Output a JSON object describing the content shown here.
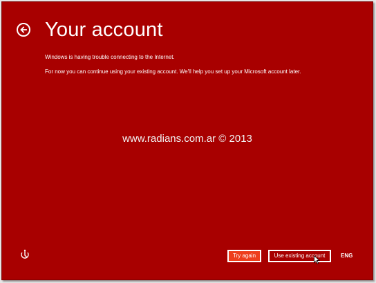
{
  "page": {
    "title": "Your account",
    "message_line1": "Windows is having trouble connecting to the Internet.",
    "message_line2": "For now you can continue using your existing account. We'll help you set up your Microsoft account later.",
    "watermark": "www.radians.com.ar © 2013"
  },
  "footer": {
    "try_again_label": "Try again",
    "use_existing_label": "Use existing account",
    "language": "ENG"
  },
  "icons": {
    "back": "back-arrow-icon",
    "ease_of_access": "ease-of-access-icon",
    "cursor": "mouse-pointer-icon"
  },
  "colors": {
    "background": "#a80000",
    "accent_button": "#ee3f1d",
    "text": "#ffffff"
  }
}
